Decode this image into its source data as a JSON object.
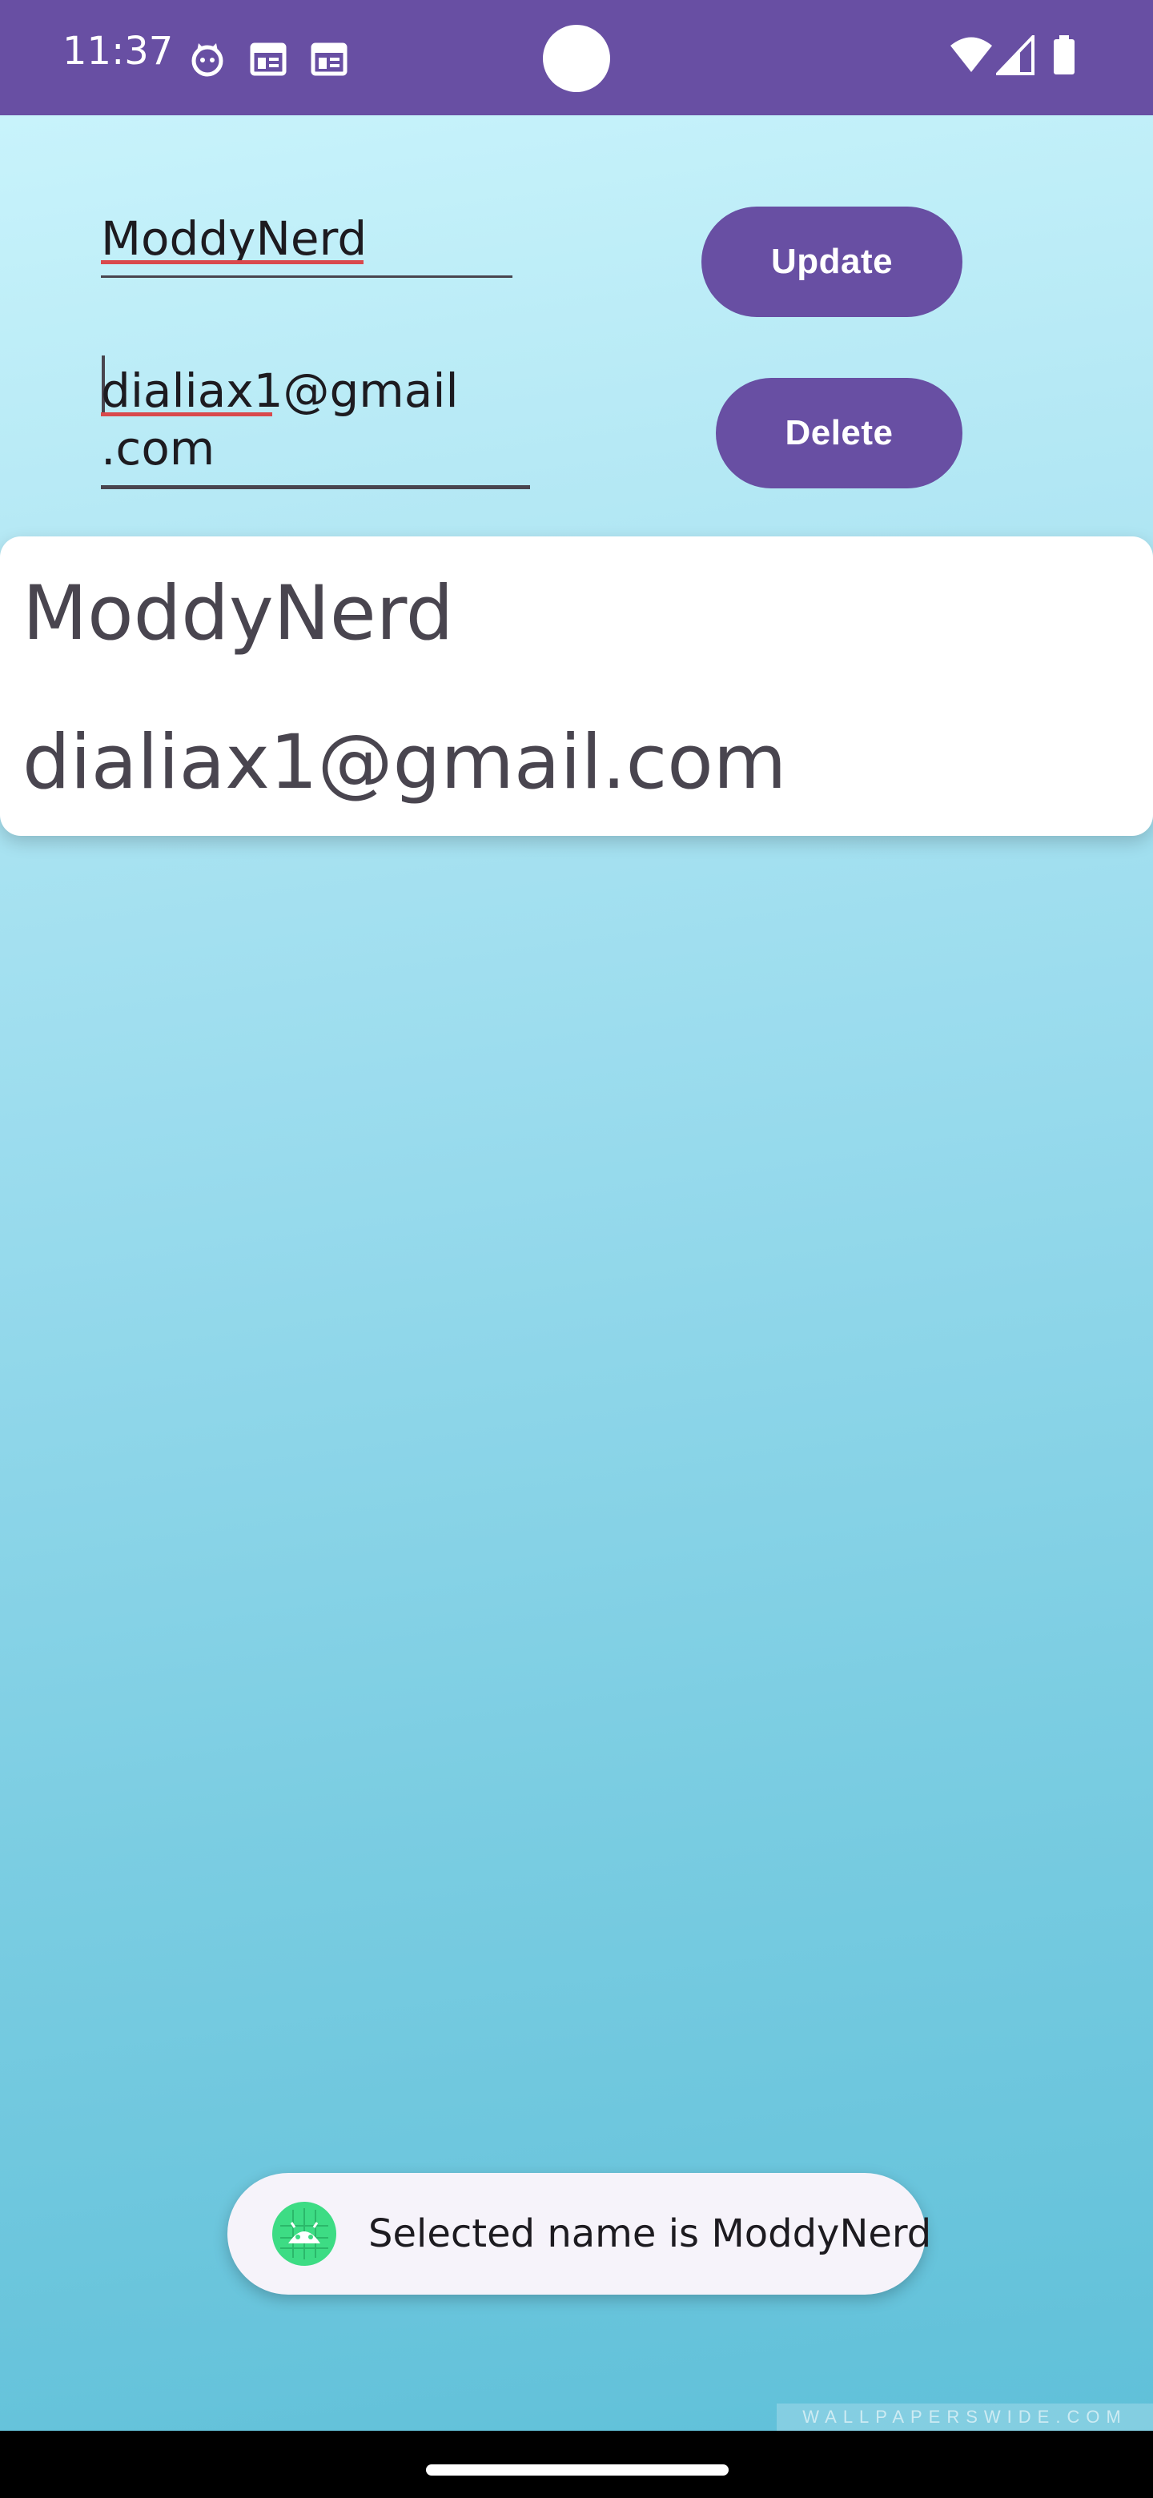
{
  "status_bar": {
    "time": "11:37",
    "background_color": "#684fa3",
    "left_icons": [
      "cat-notification-icon",
      "calendar-notification-icon",
      "calendar-notification-icon"
    ],
    "right_icons": [
      "wifi-icon",
      "cellular-signal-icon",
      "battery-icon"
    ]
  },
  "form": {
    "name_value": "ModdyNerd",
    "email_value_line1": "dialiax1@gmail",
    "email_value_line2": ".com",
    "update_label": "Update",
    "delete_label": "Delete",
    "button_color": "#684fa3",
    "spellcheck_color": "#d9494c"
  },
  "card": {
    "name": "ModdyNerd",
    "email": "dialiax1@gmail.com"
  },
  "toast": {
    "icon": "android-app-icon",
    "message": "Selected name is ModdyNerd"
  },
  "watermark": {
    "text": "WALLPAPERSWIDE.COM"
  }
}
